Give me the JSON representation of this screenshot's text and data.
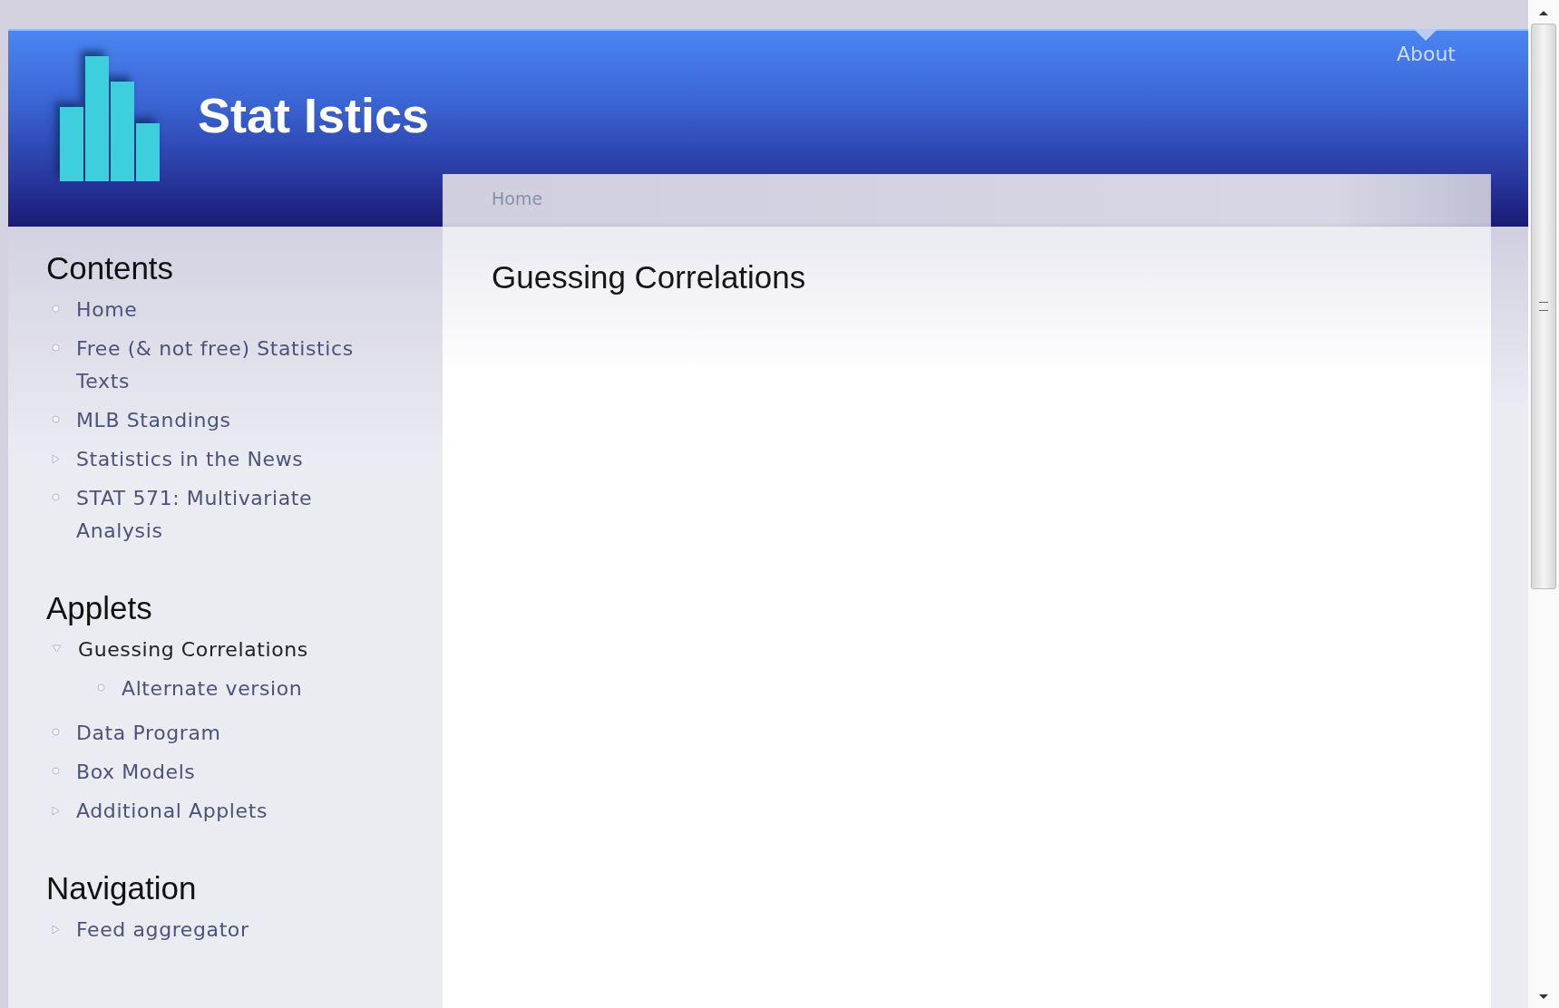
{
  "site": {
    "title": "Stat Istics",
    "nav_link": "About"
  },
  "breadcrumb": "Home",
  "page_title": "Guessing Correlations",
  "sidebar": [
    {
      "heading": "Contents",
      "items": [
        {
          "label": "Home",
          "kind": "leaf",
          "selected": false
        },
        {
          "label": "Free (& not free) Statistics Texts",
          "kind": "leaf",
          "selected": false
        },
        {
          "label": "MLB Standings",
          "kind": "leaf",
          "selected": false
        },
        {
          "label": "Statistics in the News",
          "kind": "collapsed",
          "selected": false
        },
        {
          "label": "STAT 571: Multivariate Analysis",
          "kind": "leaf",
          "selected": false
        }
      ]
    },
    {
      "heading": "Applets",
      "items": [
        {
          "label": "Guessing Correlations",
          "kind": "expanded",
          "selected": true,
          "children": [
            {
              "label": "Alternate version",
              "kind": "leaf",
              "selected": false
            }
          ]
        },
        {
          "label": "Data Program",
          "kind": "leaf",
          "selected": false
        },
        {
          "label": "Box Models",
          "kind": "leaf",
          "selected": false
        },
        {
          "label": "Additional Applets",
          "kind": "collapsed",
          "selected": false
        }
      ]
    },
    {
      "heading": "Navigation",
      "items": [
        {
          "label": "Feed aggregator",
          "kind": "collapsed",
          "selected": false
        }
      ]
    }
  ]
}
